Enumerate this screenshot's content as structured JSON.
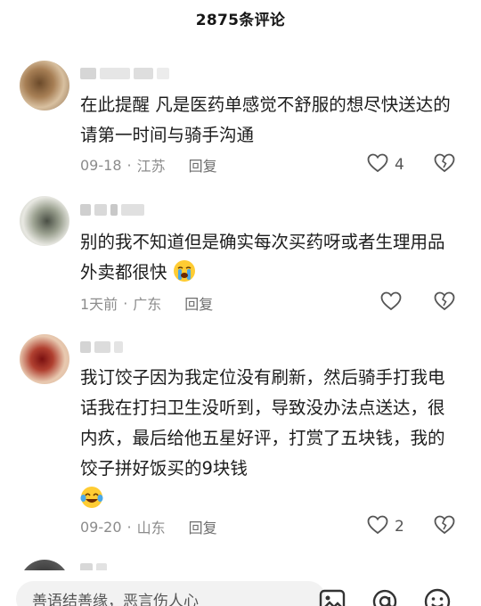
{
  "header": {
    "title": "2875条评论"
  },
  "icons": {
    "like": "heart-outline-icon",
    "dislike": "broken-heart-icon",
    "crying_emoji": "loudly-crying-face-emoji",
    "tears_of_joy_emoji": "face-with-tears-of-joy-emoji",
    "image": "image-icon",
    "mention": "at-sign-icon",
    "emoji": "smiley-face-icon"
  },
  "comments": [
    {
      "text": "在此提醒 凡是医药单感觉不舒服的想尽快送达的请第一时间与骑手沟通",
      "date": "09-18",
      "location": "江苏",
      "reply": "回复",
      "likes": "4"
    },
    {
      "text": "别的我不知道但是确实每次买药呀或者生理用品外卖都很快",
      "date": "1天前",
      "location": "广东",
      "reply": "回复",
      "likes": ""
    },
    {
      "text": "我订饺子因为我定位没有刷新，然后骑手打我电话我在打扫卫生没听到，导致没办法点送达，很内疚，最后给他五星好评，打赏了五块钱，我的饺子拼好饭买的9块钱",
      "date": "09-20",
      "location": "山东",
      "reply": "回复",
      "likes": "2"
    }
  ],
  "input": {
    "placeholder": "善语结善缘，恶言伤人心"
  }
}
